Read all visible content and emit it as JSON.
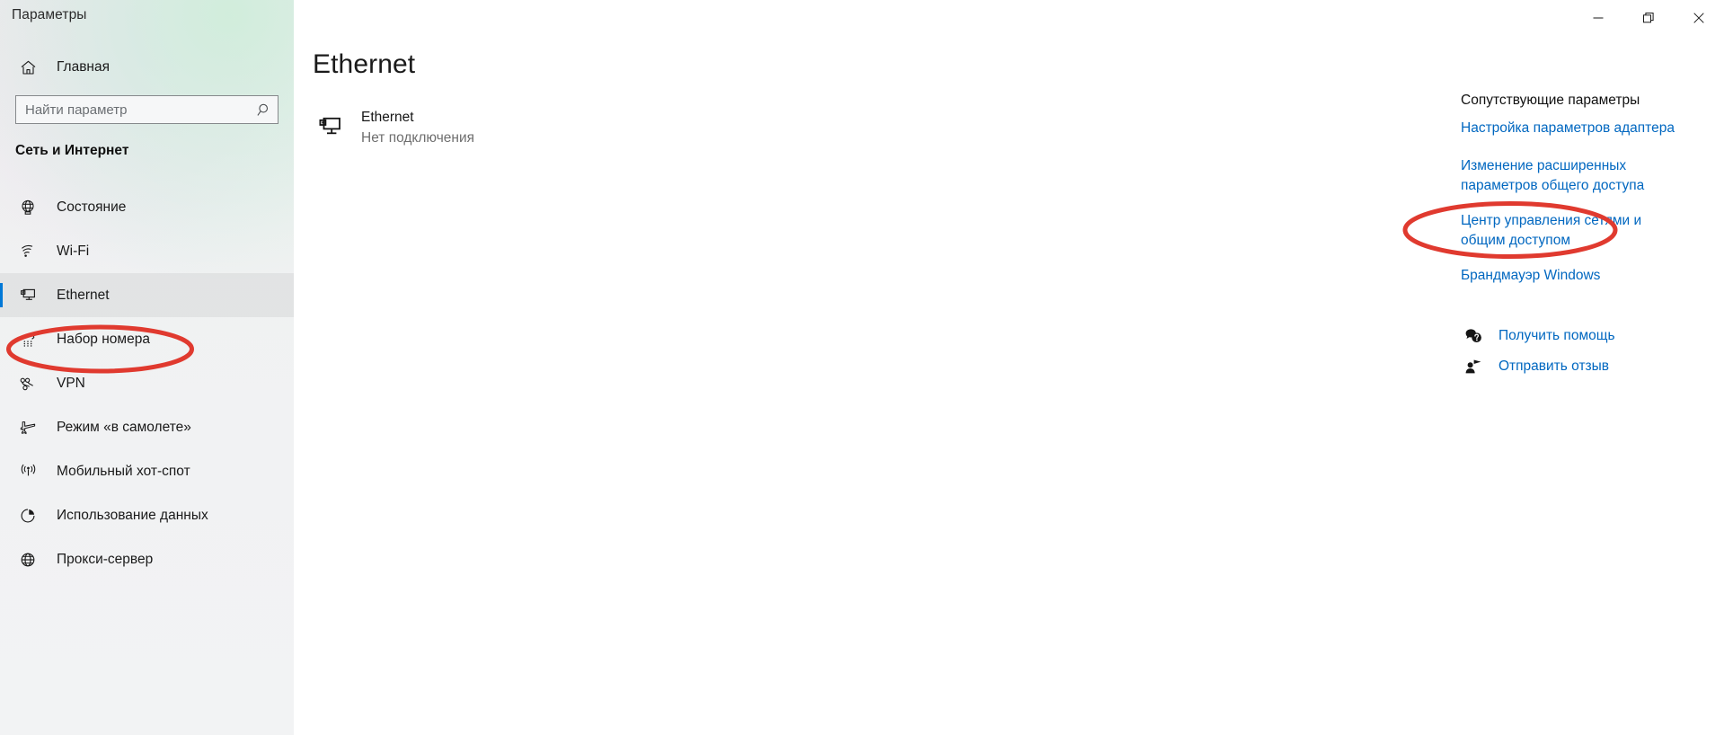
{
  "window": {
    "title": "Параметры",
    "controls": [
      {
        "name": "minimize",
        "icon": "minimize-icon"
      },
      {
        "name": "maximize",
        "icon": "restore-icon"
      },
      {
        "name": "close",
        "icon": "close-icon"
      }
    ]
  },
  "sidebar": {
    "home": {
      "label": "Главная",
      "icon": "home-icon"
    },
    "search": {
      "placeholder": "Найти параметр",
      "value": "",
      "icon": "search-icon"
    },
    "section_title": "Сеть и Интернет",
    "items": [
      {
        "label": "Состояние",
        "icon": "globe-status-icon",
        "selected": false
      },
      {
        "label": "Wi-Fi",
        "icon": "wifi-icon",
        "selected": false
      },
      {
        "label": "Ethernet",
        "icon": "ethernet-icon",
        "selected": true
      },
      {
        "label": "Набор номера",
        "icon": "dialup-phone-icon",
        "selected": false
      },
      {
        "label": "VPN",
        "icon": "vpn-icon",
        "selected": false
      },
      {
        "label": "Режим «в самолете»",
        "icon": "airplane-icon",
        "selected": false
      },
      {
        "label": "Мобильный хот-спот",
        "icon": "hotspot-icon",
        "selected": false
      },
      {
        "label": "Использование данных",
        "icon": "pie-chart-icon",
        "selected": false
      },
      {
        "label": "Прокси-сервер",
        "icon": "globe-proxy-icon",
        "selected": false
      }
    ]
  },
  "main": {
    "page_title": "Ethernet",
    "adapter": {
      "name": "Ethernet",
      "status": "Нет подключения",
      "icon": "ethernet-monitor-icon"
    }
  },
  "rail": {
    "heading": "Сопутствующие параметры",
    "links": [
      {
        "label": "Настройка параметров адаптера"
      },
      {
        "label": "Изменение расширенных параметров общего доступа"
      },
      {
        "label": "Центр управления сетями и общим доступом"
      },
      {
        "label": "Брандмауэр Windows"
      }
    ],
    "actions": [
      {
        "label": "Получить помощь",
        "icon": "help-chat-icon"
      },
      {
        "label": "Отправить отзыв",
        "icon": "feedback-person-icon"
      }
    ]
  },
  "annotations": {
    "color": "#E03A2F",
    "targets": [
      "sidebar-item-ethernet",
      "link-network-sharing-center"
    ]
  },
  "colors": {
    "accent": "#0078D7",
    "link": "#0067C0",
    "annotation_red": "#E03A2F",
    "sidebar_bg": "#F1F2F3",
    "content_bg": "#FFFFFF",
    "text": "#1A1A1A",
    "muted_text": "#6E6E6E"
  }
}
